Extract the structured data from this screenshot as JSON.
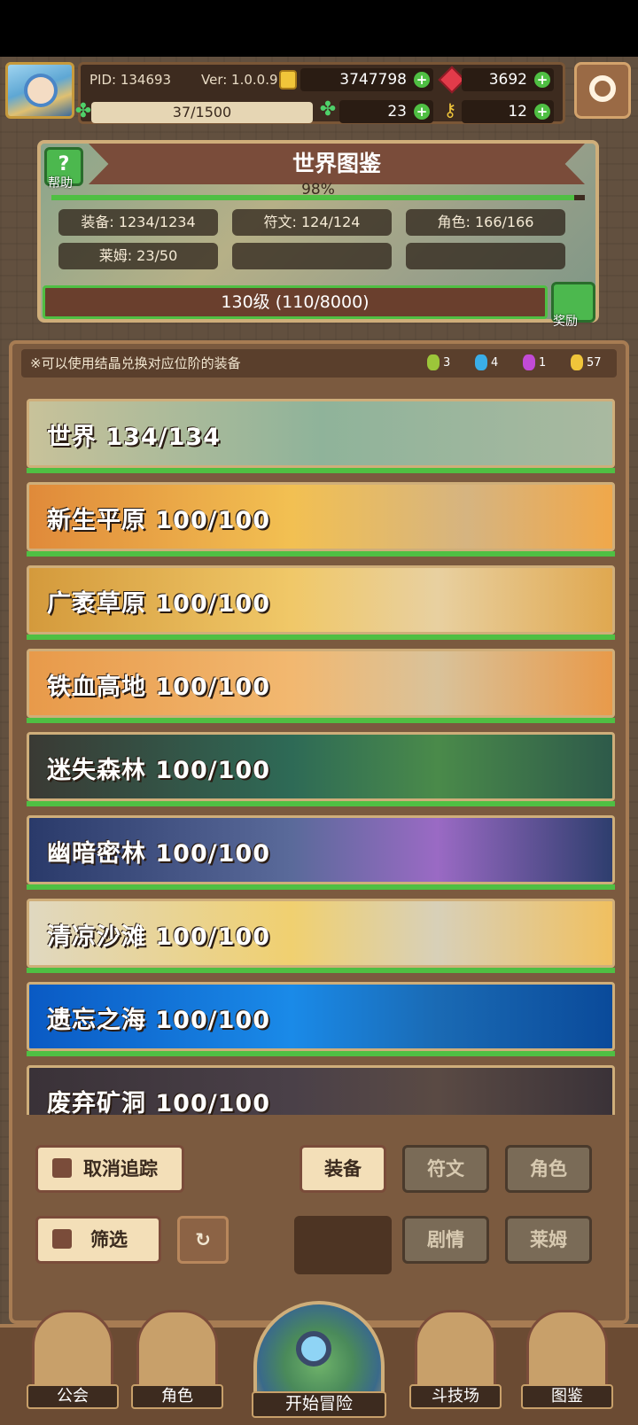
{
  "header": {
    "pid_label": "PID: 134693",
    "version_label": "Ver: 1.0.0.9",
    "gold": "3747798",
    "gems": "3692",
    "energy": "37/1500",
    "clovers": "23",
    "keys": "12"
  },
  "codex": {
    "title": "世界图鉴",
    "help_label": "帮助",
    "progress_text": "98%",
    "progress_value": 0.98,
    "stats": {
      "equipment": "装备: 1234/1234",
      "runes": "符文: 124/124",
      "characters": "角色: 166/166",
      "slimes": "莱姆: 23/50"
    },
    "level_text": "130级 (110/8000)",
    "level_progress": 0.01375,
    "reward_label": "奖励"
  },
  "notice": {
    "text": "※可以使用结晶兑换对应位阶的装备",
    "gems": [
      {
        "color": "green",
        "count": "3"
      },
      {
        "color": "blue",
        "count": "4"
      },
      {
        "color": "purple",
        "count": "1"
      },
      {
        "color": "gold",
        "count": "57"
      }
    ]
  },
  "regions": [
    {
      "name": "世界  134/134",
      "theme": "map"
    },
    {
      "name": "新生平原  100/100",
      "theme": "plains"
    },
    {
      "name": "广袤草原  100/100",
      "theme": "wheat"
    },
    {
      "name": "铁血高地  100/100",
      "theme": "highland"
    },
    {
      "name": "迷失森林  100/100",
      "theme": "forest"
    },
    {
      "name": "幽暗密林  100/100",
      "theme": "dark-forest"
    },
    {
      "name": "清凉沙滩  100/100",
      "theme": "beach"
    },
    {
      "name": "遗忘之海  100/100",
      "theme": "sea"
    },
    {
      "name": "废弃矿洞  100/100",
      "theme": "mine"
    }
  ],
  "controls": {
    "untrack": "取消追踪",
    "filter": "筛选",
    "tab_equipment": "装备",
    "tab_runes": "符文",
    "tab_characters": "角色",
    "tab_story": "剧情",
    "tab_slimes": "莱姆"
  },
  "nav": {
    "guild": "公会",
    "character": "角色",
    "start": "开始冒险",
    "arena": "斗技场",
    "codex": "图鉴"
  },
  "colors": {
    "accent_green": "#4fbf43",
    "panel_brown": "#7b5a3f",
    "gold_border": "#cfae7a"
  }
}
